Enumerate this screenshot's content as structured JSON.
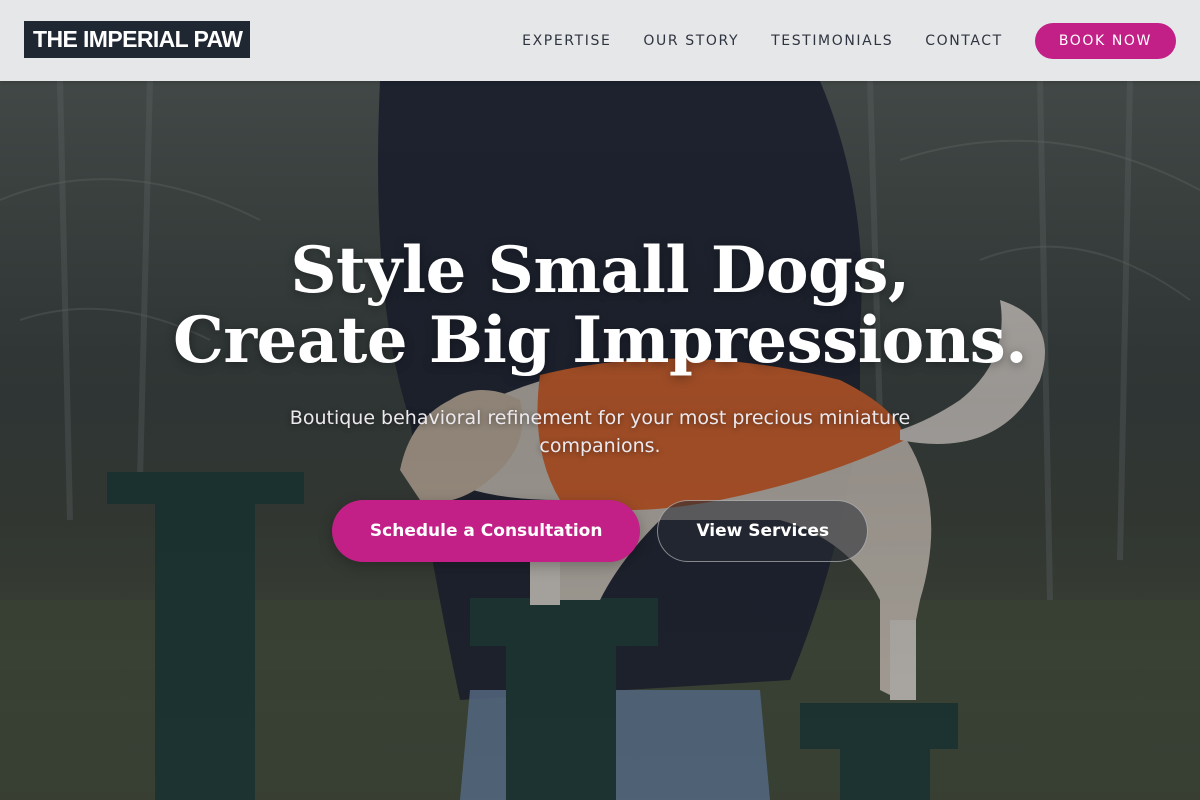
{
  "header": {
    "logo_text": "THE IMPERIAL PAW",
    "nav": [
      {
        "label": "EXPERTISE"
      },
      {
        "label": "OUR STORY"
      },
      {
        "label": "TESTIMONIALS"
      },
      {
        "label": "CONTACT"
      }
    ],
    "book_label": "BOOK NOW"
  },
  "hero": {
    "headline_line1": "Style Small Dogs,",
    "headline_line2": "Create Big Impressions.",
    "subtitle": "Boutique behavioral refinement for your most precious miniature companions.",
    "primary_cta": "Schedule a Consultation",
    "secondary_cta": "View Services"
  },
  "colors": {
    "accent": "#c21f87",
    "header_bg": "#f0f1f3",
    "logo_bg": "#1f2733"
  }
}
